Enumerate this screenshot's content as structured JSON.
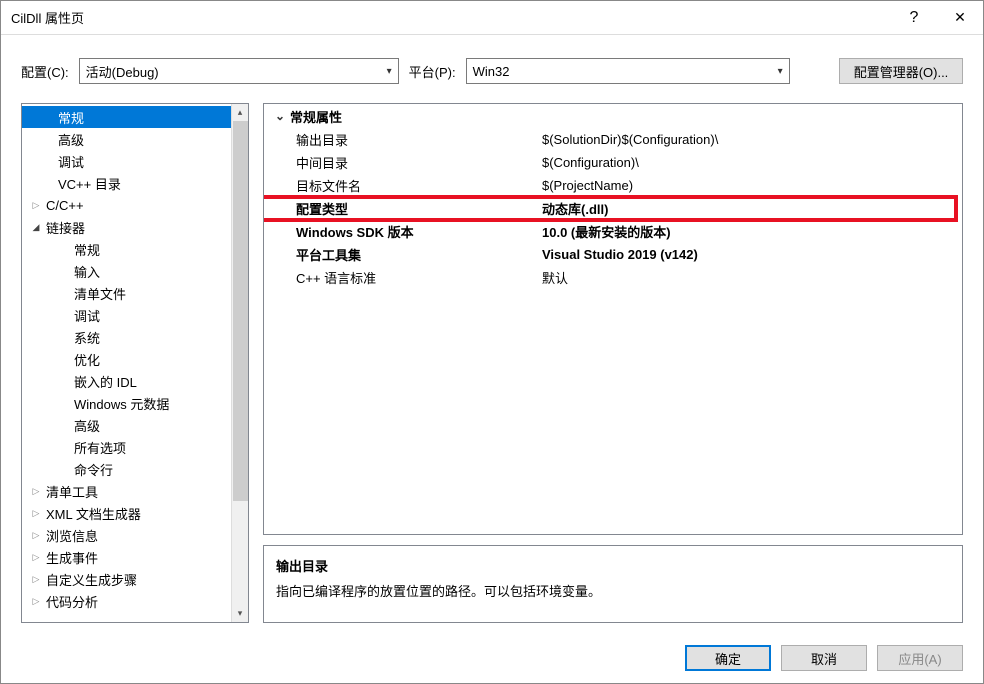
{
  "title": "CilDll 属性页",
  "configbar": {
    "config_label": "配置(C):",
    "config_value": "活动(Debug)",
    "platform_label": "平台(P):",
    "platform_value": "Win32",
    "cfg_mgr_label": "配置管理器(O)..."
  },
  "tree": [
    {
      "label": "常规",
      "indent": 1,
      "arrow": "none",
      "selected": true
    },
    {
      "label": "高级",
      "indent": 1,
      "arrow": "none"
    },
    {
      "label": "调试",
      "indent": 1,
      "arrow": "none"
    },
    {
      "label": "VC++ 目录",
      "indent": 1,
      "arrow": "none"
    },
    {
      "label": "C/C++",
      "indent": 0,
      "arrow": "collapsed"
    },
    {
      "label": "链接器",
      "indent": 0,
      "arrow": "expanded"
    },
    {
      "label": "常规",
      "indent": 2,
      "arrow": "none"
    },
    {
      "label": "输入",
      "indent": 2,
      "arrow": "none"
    },
    {
      "label": "清单文件",
      "indent": 2,
      "arrow": "none"
    },
    {
      "label": "调试",
      "indent": 2,
      "arrow": "none"
    },
    {
      "label": "系统",
      "indent": 2,
      "arrow": "none"
    },
    {
      "label": "优化",
      "indent": 2,
      "arrow": "none"
    },
    {
      "label": "嵌入的 IDL",
      "indent": 2,
      "arrow": "none"
    },
    {
      "label": "Windows 元数据",
      "indent": 2,
      "arrow": "none"
    },
    {
      "label": "高级",
      "indent": 2,
      "arrow": "none"
    },
    {
      "label": "所有选项",
      "indent": 2,
      "arrow": "none"
    },
    {
      "label": "命令行",
      "indent": 2,
      "arrow": "none"
    },
    {
      "label": "清单工具",
      "indent": 0,
      "arrow": "collapsed"
    },
    {
      "label": "XML 文档生成器",
      "indent": 0,
      "arrow": "collapsed"
    },
    {
      "label": "浏览信息",
      "indent": 0,
      "arrow": "collapsed"
    },
    {
      "label": "生成事件",
      "indent": 0,
      "arrow": "collapsed"
    },
    {
      "label": "自定义生成步骤",
      "indent": 0,
      "arrow": "collapsed"
    },
    {
      "label": "代码分析",
      "indent": 0,
      "arrow": "collapsed"
    }
  ],
  "props": {
    "group_header": "常规属性",
    "rows": [
      {
        "name": "输出目录",
        "value": "$(SolutionDir)$(Configuration)\\",
        "bold": false,
        "highlight": false
      },
      {
        "name": "中间目录",
        "value": "$(Configuration)\\",
        "bold": false,
        "highlight": false
      },
      {
        "name": "目标文件名",
        "value": "$(ProjectName)",
        "bold": false,
        "highlight": false
      },
      {
        "name": "配置类型",
        "value": "动态库(.dll)",
        "bold": true,
        "highlight": true
      },
      {
        "name": "Windows SDK 版本",
        "value": "10.0 (最新安装的版本)",
        "bold": true,
        "highlight": false
      },
      {
        "name": "平台工具集",
        "value": "Visual Studio 2019 (v142)",
        "bold": true,
        "highlight": false
      },
      {
        "name": "C++ 语言标准",
        "value": "默认",
        "bold": false,
        "highlight": false
      }
    ]
  },
  "description": {
    "title": "输出目录",
    "text": "指向已编译程序的放置位置的路径。可以包括环境变量。"
  },
  "footer": {
    "ok": "确定",
    "cancel": "取消",
    "apply": "应用(A)"
  }
}
